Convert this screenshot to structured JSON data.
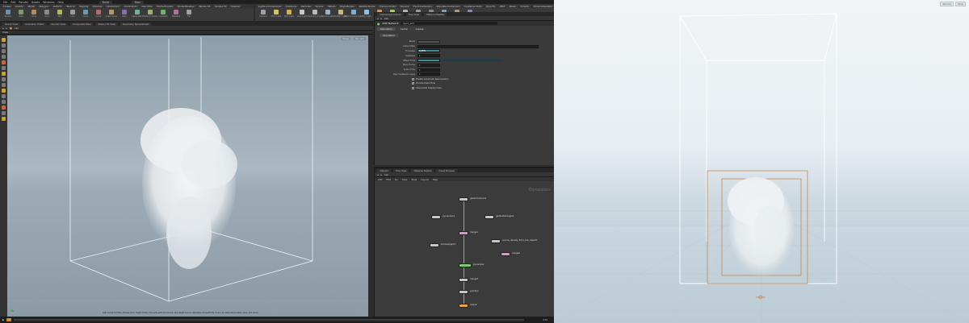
{
  "menubar": [
    "File",
    "Edit",
    "Render",
    "Assets",
    "Windows",
    "Help"
  ],
  "desktop": "Build",
  "main_label": "Main",
  "shelf_tabs_left": [
    "Create",
    "Modify",
    "Model",
    "Polygon",
    "Deform",
    "Texture",
    "Rigging",
    "Muscles",
    "Characters",
    "Constraints",
    "Hair Utils",
    "Guide Process",
    "Guide Brushes",
    "Terrain FX",
    "Simple FX",
    "Volume"
  ],
  "shelf_tabs_right": [
    "Lights and Cameras",
    "Collisions",
    "Particles",
    "Grains",
    "Vellum",
    "Rigid Bodies",
    "Particle Fluids",
    "Viscous Fluids",
    "Oceans",
    "Fluid Containers",
    "Populate Containers",
    "Container Tools",
    "Pyro FX",
    "FEM",
    "Wires",
    "Crowds",
    "Drive Simulation"
  ],
  "left_tools": [
    {
      "label": "Sphere",
      "icon": "sphere-icon",
      "color": "#6a8fb5"
    },
    {
      "label": "Tube",
      "icon": "tube-icon",
      "color": "#7a9a6a"
    },
    {
      "label": "Torus",
      "icon": "torus-icon",
      "color": "#b58a5a"
    },
    {
      "label": "Grid",
      "icon": "grid-icon",
      "color": "#8a8a8a"
    },
    {
      "label": "Null",
      "icon": "null-icon",
      "color": "#b5b55a"
    },
    {
      "label": "Line",
      "icon": "line-icon",
      "color": "#9a9a9a"
    },
    {
      "label": "Circle",
      "icon": "circle-icon",
      "color": "#6a9ab5"
    },
    {
      "label": "Curve",
      "icon": "curve-icon",
      "color": "#b56a6a"
    },
    {
      "label": "Draw Curve",
      "icon": "draw-curve-icon",
      "color": "#b5956a"
    },
    {
      "label": "Path",
      "icon": "path-icon",
      "color": "#8a6ab5"
    },
    {
      "label": "Spray Paint",
      "icon": "spray-icon",
      "color": "#6ab59a"
    },
    {
      "label": "Platonic Solids",
      "icon": "platonic-icon",
      "color": "#9ab56a"
    },
    {
      "label": "L-System",
      "icon": "lsystem-icon",
      "color": "#6ab56a"
    },
    {
      "label": "Metaball",
      "icon": "metaball-icon",
      "color": "#b56aa0"
    },
    {
      "label": "File",
      "icon": "file-icon",
      "color": "#a0a0a0"
    }
  ],
  "right_tools": [
    {
      "label": "Camera",
      "icon": "camera-icon",
      "color": "#9aa0a8"
    },
    {
      "label": "Point Light",
      "icon": "point-light-icon",
      "color": "#d8c25a"
    },
    {
      "label": "Spot Light",
      "icon": "spot-light-icon",
      "color": "#d8b04a"
    },
    {
      "label": "Area Light",
      "icon": "area-light-icon",
      "color": "#c8c8c8"
    },
    {
      "label": "Geometry Light",
      "icon": "geo-light-icon",
      "color": "#b8b8b8"
    },
    {
      "label": "Volume Light",
      "icon": "volume-light-icon",
      "color": "#9ab0c8"
    },
    {
      "label": "Distant Light",
      "icon": "distant-light-icon",
      "color": "#c8b87a"
    },
    {
      "label": "Environment Light",
      "icon": "env-light-icon",
      "color": "#7ab0d8"
    },
    {
      "label": "Sky Light",
      "icon": "sky-light-icon",
      "color": "#8ac0e8"
    },
    {
      "label": "GI Light",
      "icon": "gi-light-icon",
      "color": "#c89a6a"
    },
    {
      "label": "Caustic Light",
      "icon": "caustic-light-icon",
      "color": "#a8c86a"
    },
    {
      "label": "Portal Light",
      "icon": "portal-light-icon",
      "color": "#b0b0b0"
    },
    {
      "label": "Ambient Light",
      "icon": "ambient-light-icon",
      "color": "#9a9a9a"
    },
    {
      "label": "Stereo Camera",
      "icon": "stereo-camera-icon",
      "color": "#8a8a8a"
    },
    {
      "label": "VR Camera",
      "icon": "vr-camera-icon",
      "color": "#8a9aa8"
    },
    {
      "label": "Switcher",
      "icon": "switcher-icon",
      "color": "#a89a8a"
    },
    {
      "label": "Gamepad Camera",
      "icon": "gamepad-icon",
      "color": "#8a8aa8"
    }
  ],
  "viewer_tabs": [
    "Scene View",
    "Animation Editor",
    "Render View",
    "Composite View",
    "Motion FX View",
    "Geometry Spreadsheet"
  ],
  "viewer_path": "obj",
  "viewer_menu": "View",
  "viewport_hud": {
    "persp": "Persp",
    "cam": "No cam"
  },
  "viewport_status": "Left mouse tumbles. Middle pans. Right dollies. Ctrl+Alt+Left box-zooms. Ctrl+Right zooms. Spacebar-Ctrl-Left tilts. Hold L for alternate tumble, dolly, and zoom.",
  "param_tabs": [
    "/obj/sim/pyrosolver",
    "Tree View",
    "Material Palette"
  ],
  "param_path": "sim",
  "param_node": {
    "type": "DOP Network",
    "name": "pyro_sim"
  },
  "param_sections": [
    "Simulation",
    "Cache",
    "Guides"
  ],
  "param_subtab": "Simulation",
  "param_rows": [
    {
      "label": "Reset",
      "value": "",
      "type": "button"
    },
    {
      "label": "Initial State",
      "value": "",
      "type": "field"
    },
    {
      "label": "Timestep",
      "value": "1/$FPS",
      "type": "teal"
    },
    {
      "label": "Substeps",
      "value": "1",
      "type": "field"
    },
    {
      "label": "Offset Time",
      "value": "",
      "type": "teal"
    },
    {
      "label": "Start Frame",
      "value": "1",
      "type": "field"
    },
    {
      "label": "Scale Time",
      "value": "1",
      "type": "field"
    },
    {
      "label": "Max Feedback Loops",
      "value": "1",
      "type": "field"
    }
  ],
  "param_checks": [
    {
      "label": "Enable Automatic Resimulation",
      "checked": true
    },
    {
      "label": "Provide Data Hints",
      "checked": true
    },
    {
      "label": "Interpolate Display Data",
      "checked": true
    }
  ],
  "network_tabs": [
    "/obj/sim",
    "Tree View",
    "Material Palette",
    "Asset Browser"
  ],
  "network_path": "sim",
  "network_menu": [
    "Add",
    "Edit",
    "Go",
    "View",
    "Tools",
    "Layout",
    "Help"
  ],
  "network_context": "Dynamics",
  "nodes": [
    {
      "name": "gasturbulence1",
      "color": "#c8c8c8",
      "wide": false
    },
    {
      "name": "pyrosolver1",
      "color": "#c8c8c8",
      "wide": false
    },
    {
      "name": "gasfieldwrangle1",
      "color": "#c8c8c8",
      "wide": false
    },
    {
      "name": "merge1",
      "color": "#c9a3c9",
      "wide": false
    },
    {
      "name": "source_density_from_box_object1",
      "color": "#c8c8c8",
      "wide": false
    },
    {
      "name": "smokeobject1",
      "color": "#c8c8c8",
      "wide": false
    },
    {
      "name": "merge2",
      "color": "#c9a3c9",
      "wide": false
    },
    {
      "name": "pyrosolver",
      "color": "#7bcf6e",
      "wide": true
    },
    {
      "name": "merge3",
      "color": "#c8c8c8",
      "wide": false
    },
    {
      "name": "gravity1",
      "color": "#c8c8c8",
      "wide": false
    },
    {
      "name": "output",
      "color": "#e8a84a",
      "wide": false
    }
  ],
  "timeline": {
    "frame": "1",
    "end": "240"
  },
  "render_view_buttons": [
    "Render",
    "Stop"
  ]
}
